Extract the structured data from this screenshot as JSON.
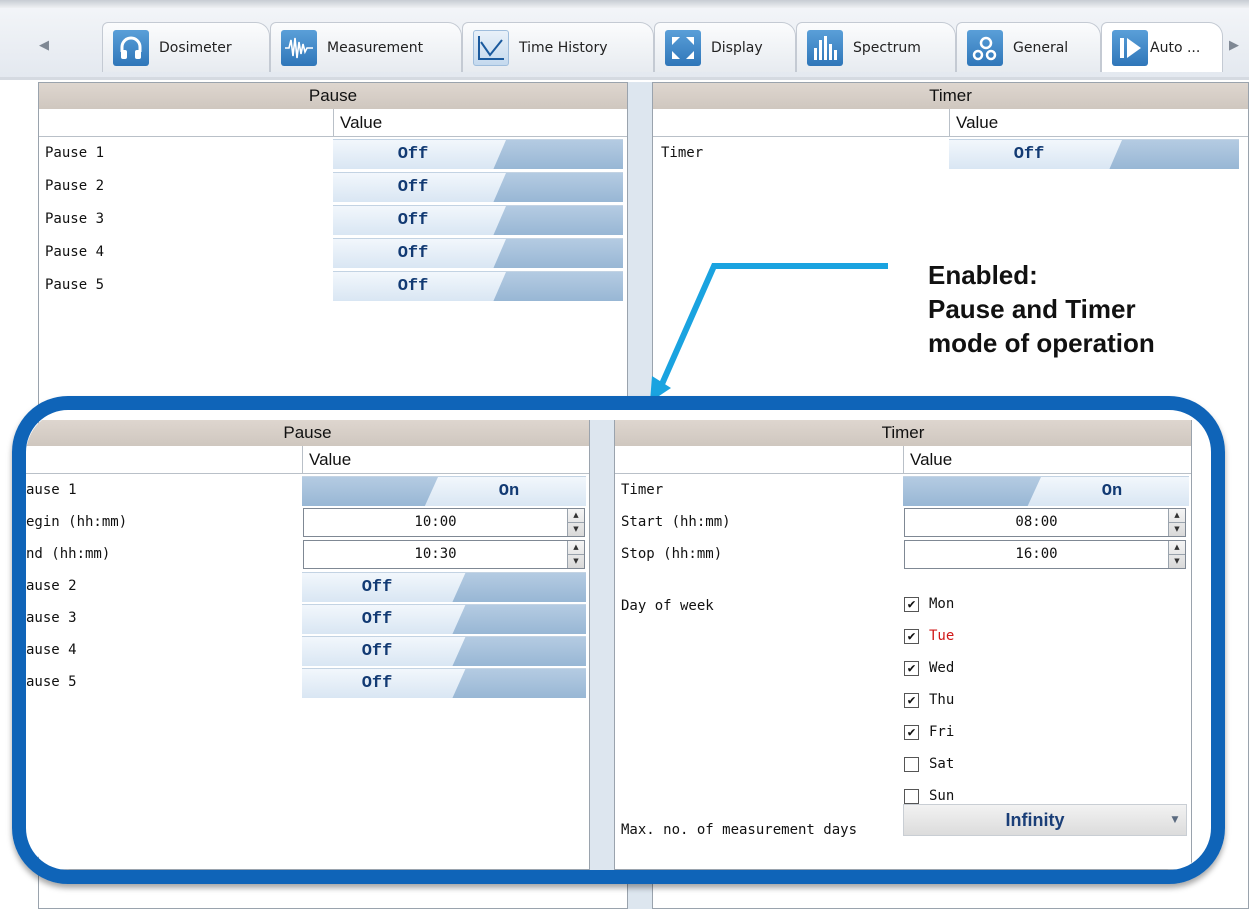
{
  "tabs": [
    {
      "label": "Dosimeter",
      "icon": "headphones-icon"
    },
    {
      "label": "Measurement",
      "icon": "waveform-icon"
    },
    {
      "label": "Time History",
      "icon": "line-chart-icon"
    },
    {
      "label": "Display",
      "icon": "expand-arrows-icon"
    },
    {
      "label": "Spectrum",
      "icon": "spectrum-bars-icon"
    },
    {
      "label": "General",
      "icon": "gears-icon"
    },
    {
      "label": "Auto ...",
      "icon": "play-auto-icon"
    }
  ],
  "upper": {
    "pause": {
      "title": "Pause",
      "value_header": "Value",
      "rows": [
        {
          "label": "Pause 1",
          "value": "Off"
        },
        {
          "label": "Pause 2",
          "value": "Off"
        },
        {
          "label": "Pause 3",
          "value": "Off"
        },
        {
          "label": "Pause 4",
          "value": "Off"
        },
        {
          "label": "Pause 5",
          "value": "Off"
        }
      ]
    },
    "timer": {
      "title": "Timer",
      "value_header": "Value",
      "row": {
        "label": "Timer",
        "value": "Off"
      }
    }
  },
  "callout": {
    "line1": "Enabled:",
    "line2": "Pause and Timer",
    "line3": "mode of operation"
  },
  "lower": {
    "pause": {
      "title": "Pause",
      "value_header": "Value",
      "pause1": {
        "label": "ause 1",
        "value": "On"
      },
      "begin": {
        "label": "egin (hh:mm)",
        "value": "10:00"
      },
      "end": {
        "label": "nd (hh:mm)",
        "value": "10:30"
      },
      "rows": [
        {
          "label": "ause 2",
          "value": "Off"
        },
        {
          "label": "ause 3",
          "value": "Off"
        },
        {
          "label": "ause 4",
          "value": "Off"
        },
        {
          "label": "ause 5",
          "value": "Off"
        }
      ]
    },
    "timer": {
      "title": "Timer",
      "value_header": "Value",
      "timer": {
        "label": "Timer",
        "value": "On"
      },
      "start": {
        "label": "Start (hh:mm)",
        "value": "08:00"
      },
      "stop": {
        "label": "Stop (hh:mm)",
        "value": "16:00"
      },
      "day_of_week_label": "Day of week",
      "days": [
        {
          "label": "Mon",
          "checked": true
        },
        {
          "label": "Tue",
          "checked": true
        },
        {
          "label": "Wed",
          "checked": true
        },
        {
          "label": "Thu",
          "checked": true
        },
        {
          "label": "Fri",
          "checked": true
        },
        {
          "label": "Sat",
          "checked": false
        },
        {
          "label": "Sun",
          "checked": false
        }
      ],
      "max_days_label": "Max. no. of measurement days",
      "max_days_value": "Infinity"
    }
  },
  "colors": {
    "highlight": "#0f64b8",
    "arrow": "#1aa3e0",
    "accent_red": "#d01818"
  }
}
